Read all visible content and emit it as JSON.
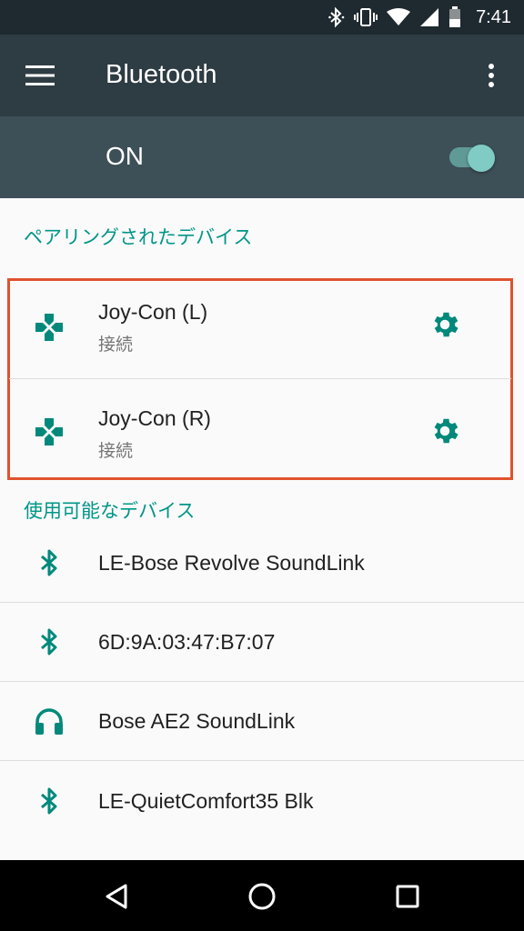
{
  "status_bar": {
    "time": "7:41"
  },
  "app_bar": {
    "title": "Bluetooth"
  },
  "switch": {
    "label": "ON",
    "state": true
  },
  "paired": {
    "header": "ペアリングされたデバイス",
    "devices": [
      {
        "name": "Joy-Con (L)",
        "status": "接続",
        "icon": "gamepad-icon"
      },
      {
        "name": "Joy-Con (R)",
        "status": "接続",
        "icon": "gamepad-icon"
      }
    ]
  },
  "available": {
    "header": "使用可能なデバイス",
    "devices": [
      {
        "name": "LE-Bose Revolve SoundLink",
        "icon": "bluetooth-icon"
      },
      {
        "name": "6D:9A:03:47:B7:07",
        "icon": "bluetooth-icon"
      },
      {
        "name": "Bose AE2 SoundLink",
        "icon": "headphones-icon"
      },
      {
        "name": "LE-QuietComfort35 Blk",
        "icon": "bluetooth-icon"
      }
    ]
  },
  "colors": {
    "accent": "#009688",
    "app_bar": "#2e3c43",
    "switch_bar": "#3d4f57",
    "highlight": "#e0522e"
  }
}
